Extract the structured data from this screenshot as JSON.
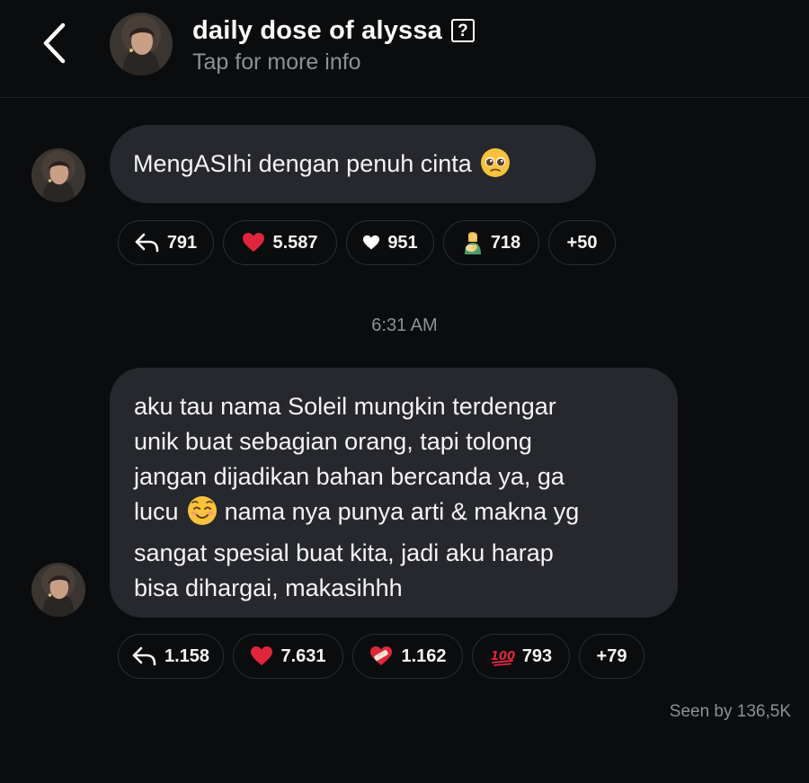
{
  "header": {
    "title": "daily dose of alyssa",
    "subtitle": "Tap for more info"
  },
  "messages": [
    {
      "lines": [
        "MengASIhi dengan penuh cinta"
      ],
      "reactions": [
        {
          "icon": "reply-icon",
          "count": "791"
        },
        {
          "icon": "red-heart-icon",
          "count": "5.587"
        },
        {
          "icon": "white-heart-icon",
          "count": "951"
        },
        {
          "icon": "breastfeeding-icon",
          "count": "718"
        },
        {
          "icon": "",
          "count": "+50"
        }
      ]
    },
    {
      "lines": [
        "aku tau nama Soleil mungkin terdengar",
        "unik buat sebagian orang, tapi tolong",
        "jangan dijadikan bahan bercanda ya, ga",
        "lucu",
        "nama nya punya arti & makna yg",
        "sangat spesial buat kita, jadi aku harap",
        "bisa dihargai, makasihhh"
      ],
      "reactions": [
        {
          "icon": "reply-icon",
          "count": "1.158"
        },
        {
          "icon": "red-heart-icon",
          "count": "7.631"
        },
        {
          "icon": "mending-heart-icon",
          "count": "1.162"
        },
        {
          "icon": "hundred-points-icon",
          "count": "793"
        },
        {
          "icon": "",
          "count": "+79"
        }
      ]
    }
  ],
  "timestamp": "6:31 AM",
  "seen": "Seen by 136,5K",
  "colors": {
    "background": "#0b0c0e",
    "bubble": "#26282d",
    "muted_text": "#8e9095",
    "heart": "#e0263c"
  }
}
